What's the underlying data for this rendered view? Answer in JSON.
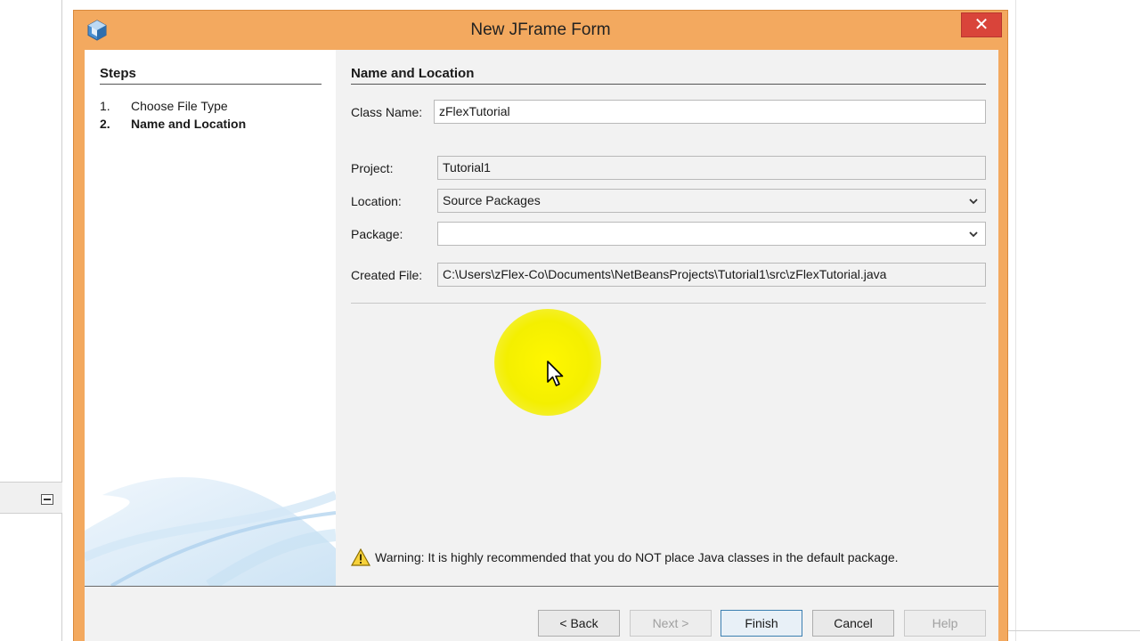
{
  "dialog": {
    "title": "New JFrame Form",
    "close_label": "✕"
  },
  "steps": {
    "heading": "Steps",
    "items": [
      {
        "number": "1.",
        "label": "Choose File Type",
        "current": false
      },
      {
        "number": "2.",
        "label": "Name and Location",
        "current": true
      }
    ]
  },
  "form": {
    "heading": "Name and Location",
    "class_name": {
      "label": "Class Name:",
      "value": "zFlexTutorial"
    },
    "project": {
      "label": "Project:",
      "value": "Tutorial1"
    },
    "location": {
      "label": "Location:",
      "value": "Source Packages"
    },
    "package": {
      "label": "Package:",
      "value": ""
    },
    "created_file": {
      "label": "Created File:",
      "value": "C:\\Users\\zFlex-Co\\Documents\\NetBeansProjects\\Tutorial1\\src\\zFlexTutorial.java"
    },
    "warning": "Warning: It is highly recommended that you do NOT place Java classes in the default package."
  },
  "buttons": {
    "back": "< Back",
    "next": "Next >",
    "finish": "Finish",
    "cancel": "Cancel",
    "help": "Help"
  },
  "colors": {
    "frame": "#f3a95f",
    "close": "#d9443a",
    "highlight": "#fff700"
  },
  "icons": [
    "netbeans-cube-icon",
    "close-icon",
    "chevron-down-icon",
    "warning-icon",
    "mouse-cursor-icon",
    "minimize-icon"
  ]
}
